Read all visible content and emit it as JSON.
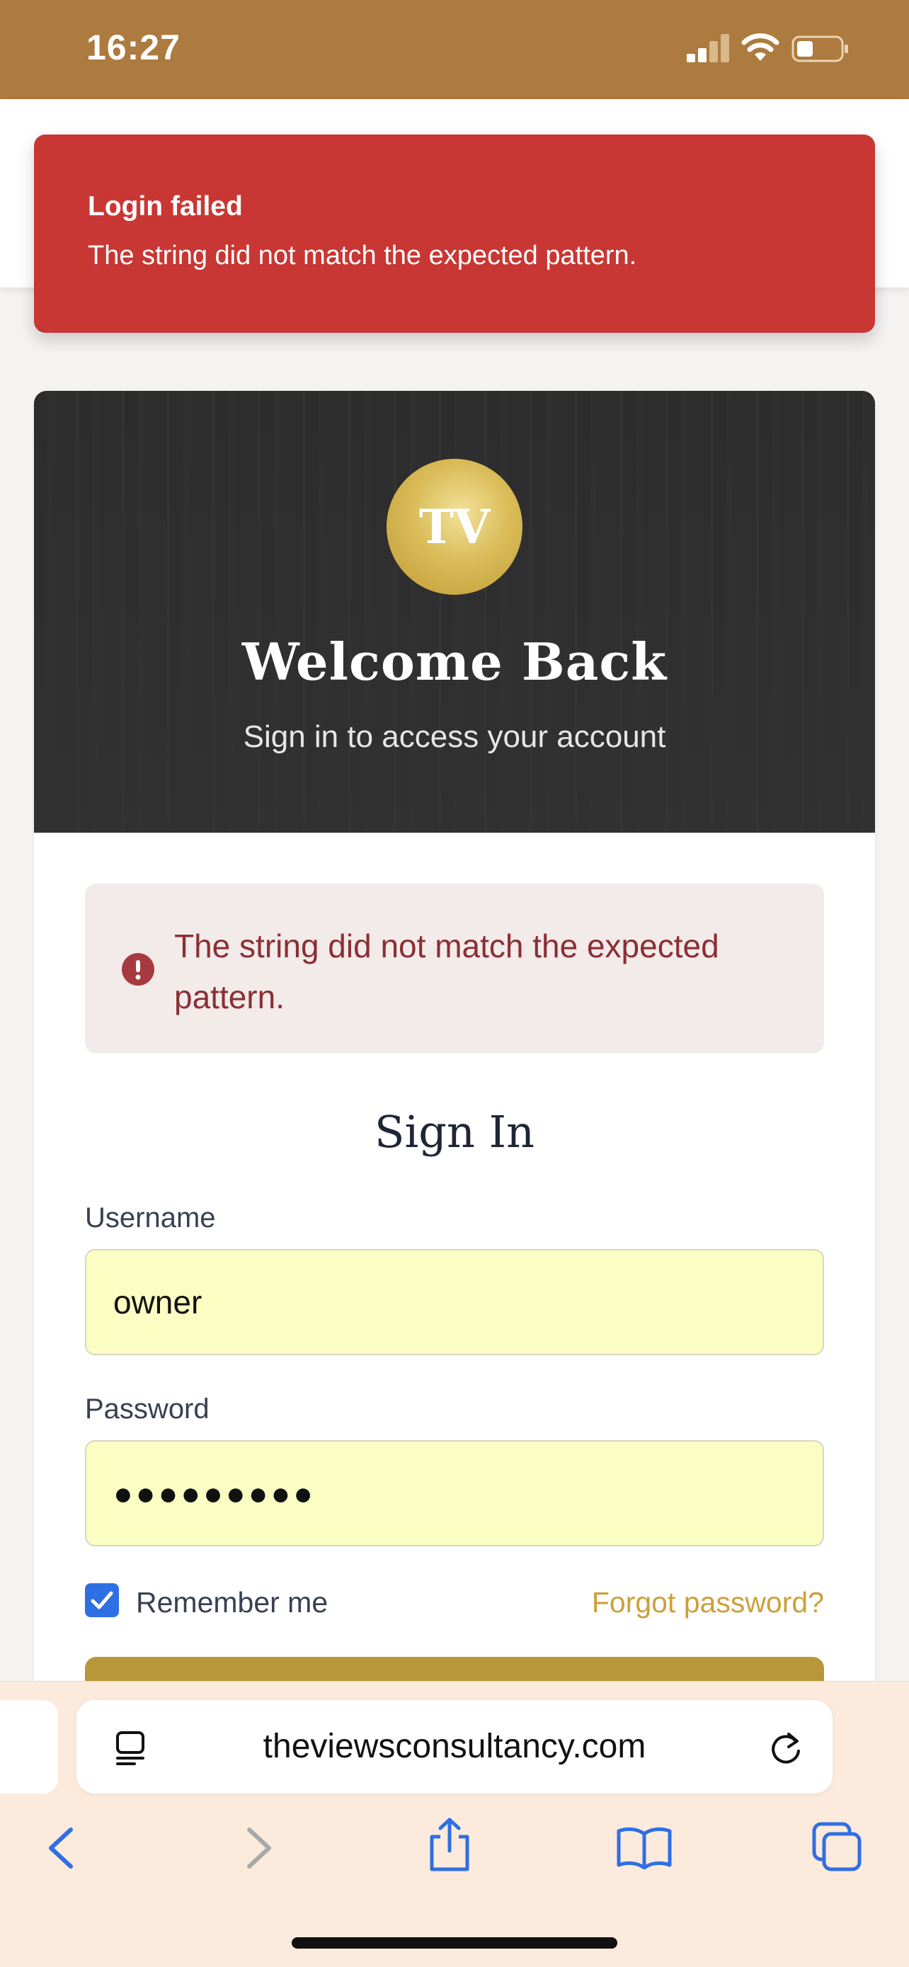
{
  "status_bar": {
    "time": "16:27"
  },
  "toast": {
    "title": "Login failed",
    "message": "The string did not match the expected pattern."
  },
  "hero": {
    "logo_text": "TV",
    "title": "Welcome Back",
    "subtitle": "Sign in to access your account"
  },
  "alert": {
    "message": "The string did not match the expected pattern."
  },
  "form": {
    "title": "Sign In",
    "username_label": "Username",
    "username_value": "owner",
    "password_label": "Password",
    "password_value": "●●●●●●●●●",
    "remember_label": "Remember me",
    "remember_checked": true,
    "forgot_link": "Forgot password?"
  },
  "browser": {
    "url": "theviewsconsultancy.com"
  },
  "colors": {
    "status_bar": "#ad7a3f",
    "toast": "#c83733",
    "gold": "#b8973b",
    "link": "#cda03a",
    "checkbox": "#2f6fe4",
    "input_bg": "#fafec3"
  }
}
